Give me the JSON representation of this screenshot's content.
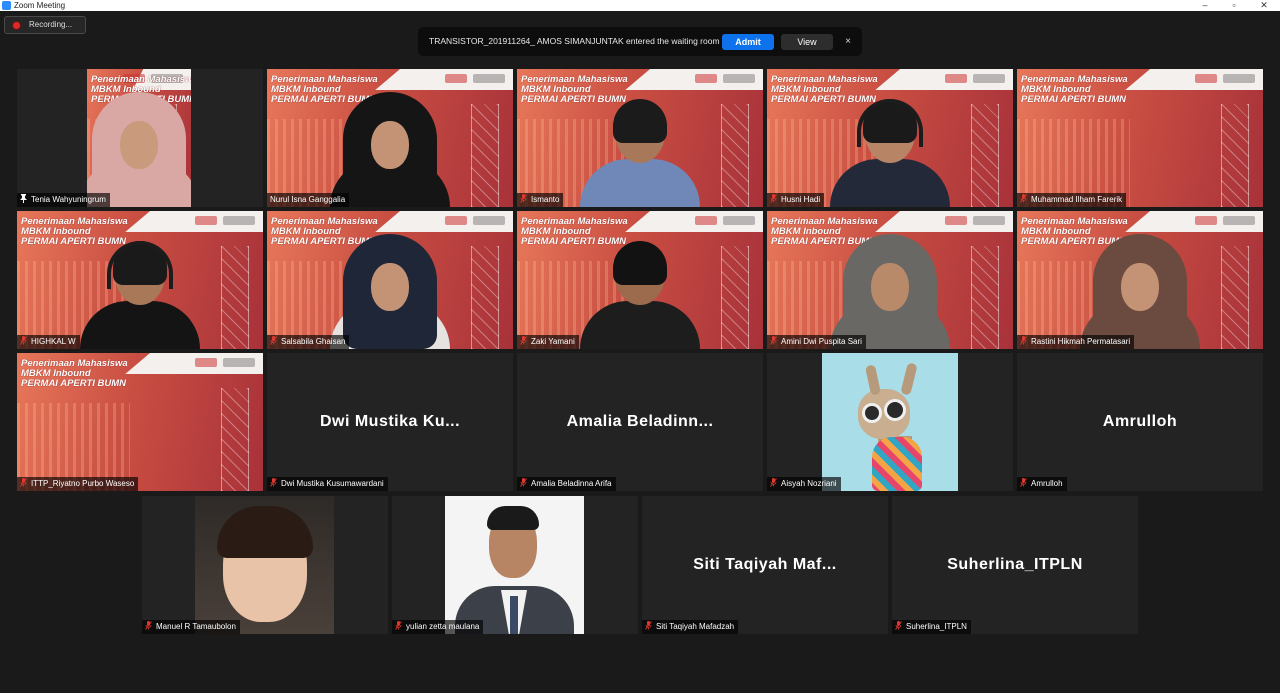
{
  "window": {
    "title": "Zoom Meeting",
    "controls": {
      "minimize": "–",
      "restore": "▫",
      "close": "✕"
    }
  },
  "recording": {
    "label": "Recording..."
  },
  "notification": {
    "message": "TRANSISTOR_201911264_ AMOS SIMANJUNTAK entered the waiting room",
    "admit_label": "Admit",
    "view_label": "View",
    "close_label": "×"
  },
  "slide": {
    "title": "Penerimaan Mahasiswa\nMBKM Inbound\nPERMAI APERTI BUMN"
  },
  "participants": [
    {
      "name": "Tenia Wahyuningrum",
      "icon": "pin-icon",
      "kind": "slide-person",
      "look": "hijab"
    },
    {
      "name": "Nurul Isna Ganggalia",
      "icon": "none",
      "kind": "slide-person",
      "look": "hijab-dark",
      "speaking": true
    },
    {
      "name": "Ismanto",
      "icon": "mic-muted-icon",
      "kind": "slide-person",
      "look": "man-batik"
    },
    {
      "name": "Husni Hadi",
      "icon": "mic-muted-icon",
      "kind": "slide-person",
      "look": "headset"
    },
    {
      "name": "Muhammad Ilham Farerik",
      "icon": "mic-muted-icon",
      "kind": "slide"
    },
    {
      "name": "HIGHKAL W",
      "icon": "mic-muted-icon",
      "kind": "slide-person",
      "look": "headset-black"
    },
    {
      "name": "Salsabila Ghaisan",
      "icon": "mic-muted-icon",
      "kind": "slide-person",
      "look": "hijab-navy"
    },
    {
      "name": "Zaki Yamani",
      "icon": "mic-muted-icon",
      "kind": "slide-person",
      "look": "man-dark"
    },
    {
      "name": "Amini Dwi Puspita Sari",
      "icon": "mic-muted-icon",
      "kind": "slide-person",
      "look": "hijab-grey"
    },
    {
      "name": "Rastini Hikmah Permatasari",
      "icon": "mic-muted-icon",
      "kind": "slide-person",
      "look": "hijab-brown"
    },
    {
      "name": "ITTP_Riyatno Purbo Waseso",
      "icon": "mic-muted-icon",
      "kind": "slide"
    },
    {
      "name": "Dwi Mustika Kusumawardani",
      "display": "Dwi Mustika Ku...",
      "icon": "mic-muted-icon",
      "kind": "name"
    },
    {
      "name": "Amalia Beladinna Arifa",
      "display": "Amalia Beladinn...",
      "icon": "mic-muted-icon",
      "kind": "name"
    },
    {
      "name": "Aisyah Nozriani",
      "icon": "mic-muted-icon",
      "kind": "llama"
    },
    {
      "name": "Amrulloh",
      "display": "Amrulloh",
      "icon": "mic-muted-icon",
      "kind": "name"
    },
    {
      "name": "Manuel R Tamaubolon",
      "icon": "mic-muted-icon",
      "kind": "baby"
    },
    {
      "name": "yulian zetta maulana",
      "icon": "mic-muted-icon",
      "kind": "portrait"
    },
    {
      "name": "Siti Taqiyah Mafadzah",
      "display": "Siti Taqiyah Maf...",
      "icon": "mic-muted-icon",
      "kind": "name"
    },
    {
      "name": "Suherlina_ITPLN",
      "display": "Suherlina_ITPLN",
      "icon": "mic-muted-icon",
      "kind": "name"
    }
  ],
  "colors": {
    "muted": "#e0382f",
    "speaking": "#c8e04a",
    "admit": "#0e72ed"
  }
}
